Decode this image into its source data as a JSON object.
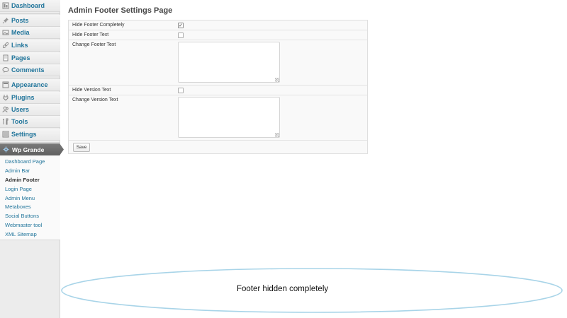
{
  "sidebar": {
    "items": [
      {
        "label": "Dashboard",
        "icon": "dashboard-icon"
      },
      {
        "label": "Posts",
        "icon": "pin-icon"
      },
      {
        "label": "Media",
        "icon": "media-icon"
      },
      {
        "label": "Links",
        "icon": "link-icon"
      },
      {
        "label": "Pages",
        "icon": "pages-icon"
      },
      {
        "label": "Comments",
        "icon": "comment-icon"
      },
      {
        "label": "Appearance",
        "icon": "appearance-icon"
      },
      {
        "label": "Plugins",
        "icon": "plugin-icon"
      },
      {
        "label": "Users",
        "icon": "users-icon"
      },
      {
        "label": "Tools",
        "icon": "tools-icon"
      },
      {
        "label": "Settings",
        "icon": "settings-icon"
      }
    ],
    "active_menu": {
      "label": "Wp Grande",
      "icon": "gear-icon"
    },
    "submenu": [
      {
        "label": "Dashboard Page"
      },
      {
        "label": "Admin Bar"
      },
      {
        "label": "Admin Footer",
        "current": true
      },
      {
        "label": "Login Page"
      },
      {
        "label": "Admin Menu"
      },
      {
        "label": "Metaboxes"
      },
      {
        "label": "Social Buttons"
      },
      {
        "label": "Webmaster tool"
      },
      {
        "label": "XML Sitemap"
      }
    ]
  },
  "main": {
    "title": "Admin Footer Settings Page",
    "fields": {
      "hide_footer_completely": {
        "label": "Hide Footer Completely",
        "checked": true
      },
      "hide_footer_text": {
        "label": "Hide Footer Text",
        "checked": false
      },
      "change_footer_text": {
        "label": "Change Footer Text",
        "value": ""
      },
      "hide_version_text": {
        "label": "Hide Version Text",
        "checked": false
      },
      "change_version_text": {
        "label": "Change Version Text",
        "value": ""
      }
    },
    "save_label": "Save"
  },
  "annotation": {
    "text": "Footer hidden completely",
    "color": "#a8d4e8"
  },
  "colors": {
    "link": "#21759b",
    "sidebar_bg": "#ececec",
    "active_menu_bg": "#6d6d6d"
  }
}
